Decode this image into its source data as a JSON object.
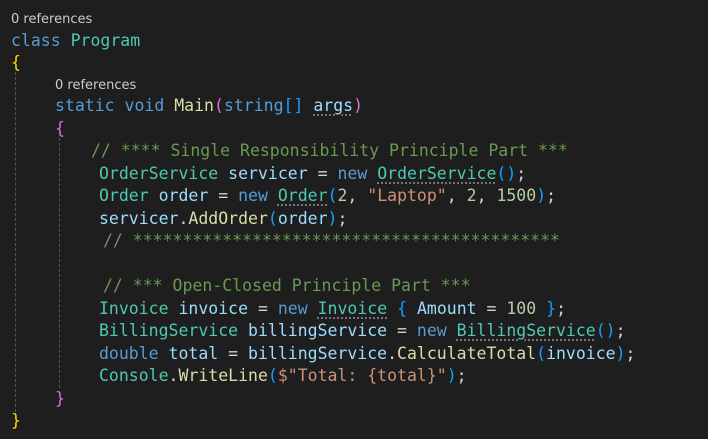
{
  "codelens": {
    "program_refs": "0 references",
    "main_refs": "0 references"
  },
  "code": {
    "kw_class": "class",
    "class_name": "Program",
    "open_class": "{",
    "kw_static": "static",
    "kw_void": "void",
    "fn_main": "Main",
    "paren_open": "(",
    "kw_string": "string",
    "array_brackets": "[]",
    "param_args": "args",
    "paren_close": ")",
    "open_main": "{",
    "comment_srp": "// **** Single Responsibility Principle Part ***",
    "l1_type": "OrderService",
    "l1_var": "servicer",
    "op_eq": "=",
    "kw_new": "new",
    "l1_ctor": "OrderService",
    "l1_call": "()",
    "semi": ";",
    "l2_type": "Order",
    "l2_var": "order",
    "l2_ctor": "Order",
    "l2_arg1": "2",
    "l2_arg2": "\"Laptop\"",
    "l2_arg3": "2",
    "l2_arg4": "1500",
    "l3_obj": "servicer",
    "l3_method": "AddOrder",
    "l3_arg": "order",
    "comment_divider": "// *******************************************",
    "comment_ocp": "// *** Open-Closed Principle Part ***",
    "l4_type": "Invoice",
    "l4_var": "invoice",
    "l4_ctor": "Invoice",
    "l4_brace_open": "{",
    "l4_prop": "Amount",
    "l4_value": "100",
    "l4_brace_close": "}",
    "l5_type": "BillingService",
    "l5_var": "billingService",
    "l5_ctor": "BillingService",
    "l6_kw": "double",
    "l6_var": "total",
    "l6_obj": "billingService",
    "l6_method": "CalculateTotal",
    "l6_arg": "invoice",
    "l7_type": "Console",
    "l7_method": "WriteLine",
    "l7_str": "$\"Total: {total}\"",
    "close_main": "}",
    "close_class": "}"
  },
  "colors": {
    "background": "#1e1e1e",
    "keyword": "#569cd6",
    "type": "#4ec9b0",
    "function": "#dcdcaa",
    "string": "#ce9178",
    "number": "#b5cea8",
    "comment": "#6a9955",
    "variable": "#9cdcfe"
  }
}
